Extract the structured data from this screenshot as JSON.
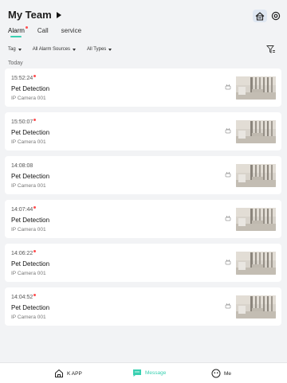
{
  "header": {
    "title": "My Team",
    "icons": {
      "home": "home-icon",
      "settings": "settings-icon"
    }
  },
  "tabs": [
    {
      "label": "Alarm",
      "active": true,
      "has_dot": true
    },
    {
      "label": "Call",
      "active": false
    },
    {
      "label": "service",
      "active": false
    }
  ],
  "filters": {
    "tag": "Tag",
    "alarm_sources": "All Alarm Sources",
    "types": "All Types",
    "icon": "filter-icon"
  },
  "section_date": "Today",
  "alarms": [
    {
      "time": "15:52:24",
      "unread": true,
      "title": "Pet Detection",
      "source": "IP Camera 001"
    },
    {
      "time": "15:50:07",
      "unread": true,
      "title": "Pet Detection",
      "source": "IP Camera 001"
    },
    {
      "time": "14:08:08",
      "unread": false,
      "title": "Pet Detection",
      "source": "IP Camera 001"
    },
    {
      "time": "14:07:44",
      "unread": true,
      "title": "Pet Detection",
      "source": "IP Camera 001"
    },
    {
      "time": "14:06:22",
      "unread": true,
      "title": "Pet Detection",
      "source": "IP Camera 001"
    },
    {
      "time": "14:04:52",
      "unread": true,
      "title": "Pet Detection",
      "source": "IP Camera 001"
    }
  ],
  "bottom_nav": [
    {
      "label": "K APP",
      "icon": "home-icon",
      "active": false
    },
    {
      "label": "Message",
      "icon": "message-icon",
      "active": true
    },
    {
      "label": "Me",
      "icon": "me-icon",
      "active": false
    }
  ],
  "colors": {
    "accent": "#3ad0b1",
    "unread_dot": "#ff4d4f",
    "background": "#f2f3f5"
  }
}
